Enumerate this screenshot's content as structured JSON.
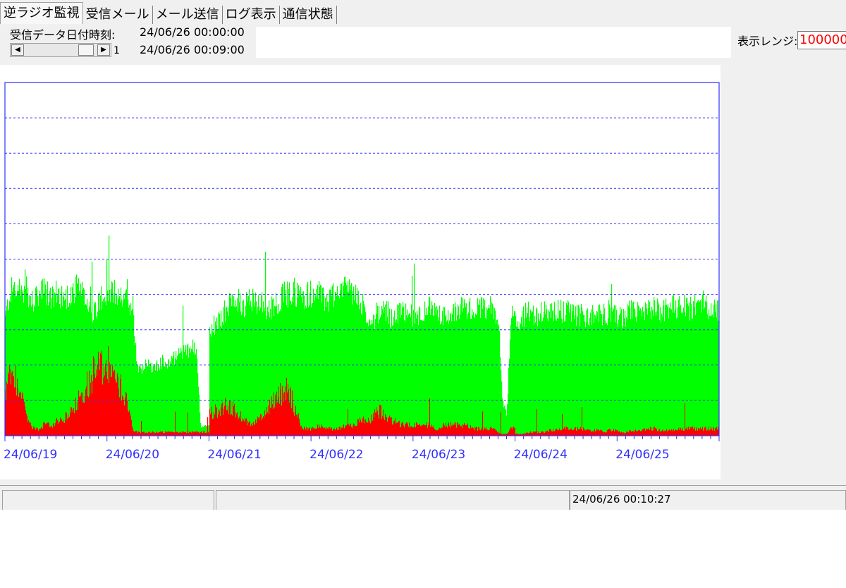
{
  "tabs": [
    {
      "label": "逆ラジオ監視",
      "active": true
    },
    {
      "label": "受信メール",
      "active": false
    },
    {
      "label": "メール送信",
      "active": false
    },
    {
      "label": "ログ表示",
      "active": false
    },
    {
      "label": "通信状態",
      "active": false
    }
  ],
  "header": {
    "received_label": "受信データ日付時刻:",
    "start_time": "24/06/26 00:00:00",
    "end_time": "24/06/26 00:09:00",
    "scroll_value": "1",
    "range_label": "表示レンジ:",
    "range_value": "100000"
  },
  "colors": {
    "green_series": "#00ff00",
    "red_series": "#ff0000",
    "axis": "#3030ff",
    "range_text": "#ff0000"
  },
  "chart_data": {
    "type": "area",
    "x_tick_labels": [
      "24/06/19",
      "24/06/20",
      "24/06/21",
      "24/06/22",
      "24/06/23",
      "24/06/24",
      "24/06/25"
    ],
    "ylim": [
      0,
      100000
    ],
    "gridlines": 10,
    "grid": true,
    "series": [
      {
        "color": "#00ff00",
        "daily_profile": [
          {
            "day": 0,
            "values": [
              0.33,
              0.4,
              0.42,
              0.41,
              0.4,
              0.39,
              0.38,
              0.38,
              0.4,
              0.41,
              0.4,
              0.39,
              0.4,
              0.4,
              0.39,
              0.4,
              0.41,
              0.42,
              0.4,
              0.38,
              0.36,
              0.35,
              0.38,
              0.4
            ]
          },
          {
            "day": 1,
            "values": [
              0.38,
              0.4,
              0.41,
              0.4,
              0.39,
              0.38,
              0.37,
              0.2,
              0.19,
              0.2,
              0.2,
              0.19,
              0.2,
              0.21,
              0.2,
              0.22,
              0.22,
              0.23,
              0.24,
              0.24,
              0.25,
              0.24,
              0.02,
              0.03
            ]
          },
          {
            "day": 2,
            "values": [
              0.3,
              0.31,
              0.32,
              0.34,
              0.36,
              0.37,
              0.38,
              0.38,
              0.37,
              0.38,
              0.39,
              0.38,
              0.37,
              0.36,
              0.36,
              0.37,
              0.38,
              0.39,
              0.4,
              0.4,
              0.41,
              0.4,
              0.39,
              0.4
            ]
          },
          {
            "day": 3,
            "values": [
              0.4,
              0.41,
              0.4,
              0.39,
              0.38,
              0.4,
              0.41,
              0.42,
              0.42,
              0.41,
              0.4,
              0.39,
              0.37,
              0.33,
              0.32,
              0.33,
              0.34,
              0.36,
              0.35,
              0.33,
              0.34,
              0.36,
              0.35,
              0.34
            ]
          },
          {
            "day": 4,
            "values": [
              0.33,
              0.34,
              0.35,
              0.36,
              0.36,
              0.35,
              0.35,
              0.34,
              0.33,
              0.34,
              0.35,
              0.36,
              0.36,
              0.36,
              0.35,
              0.36,
              0.36,
              0.35,
              0.36,
              0.35,
              0.33,
              0.1,
              0.06,
              0.34
            ]
          },
          {
            "day": 5,
            "values": [
              0.34,
              0.33,
              0.34,
              0.35,
              0.34,
              0.34,
              0.35,
              0.36,
              0.35,
              0.35,
              0.36,
              0.35,
              0.36,
              0.35,
              0.34,
              0.34,
              0.34,
              0.33,
              0.34,
              0.35,
              0.34,
              0.34,
              0.35,
              0.34
            ]
          },
          {
            "day": 6,
            "values": [
              0.34,
              0.33,
              0.34,
              0.35,
              0.36,
              0.35,
              0.34,
              0.35,
              0.36,
              0.36,
              0.35,
              0.36,
              0.36,
              0.37,
              0.36,
              0.37,
              0.36,
              0.36,
              0.37,
              0.37,
              0.38,
              0.37,
              0.36,
              0.36
            ]
          }
        ]
      },
      {
        "color": "#ff0000",
        "daily_profile": [
          {
            "day": 0,
            "values": [
              0.12,
              0.16,
              0.15,
              0.13,
              0.1,
              0.06,
              0.03,
              0.02,
              0.02,
              0.03,
              0.03,
              0.03,
              0.04,
              0.04,
              0.05,
              0.06,
              0.08,
              0.1,
              0.12,
              0.14,
              0.16,
              0.18,
              0.2,
              0.18
            ]
          },
          {
            "day": 1,
            "values": [
              0.2,
              0.18,
              0.15,
              0.14,
              0.12,
              0.09,
              0.02,
              0.01,
              0.01,
              0.01,
              0.01,
              0.01,
              0.01,
              0.01,
              0.01,
              0.01,
              0.01,
              0.01,
              0.01,
              0.01,
              0.01,
              0.01,
              0.01,
              0.01
            ]
          },
          {
            "day": 2,
            "values": [
              0.06,
              0.07,
              0.07,
              0.08,
              0.09,
              0.08,
              0.07,
              0.06,
              0.05,
              0.04,
              0.03,
              0.04,
              0.05,
              0.06,
              0.08,
              0.1,
              0.11,
              0.12,
              0.13,
              0.12,
              0.08,
              0.05,
              0.02,
              0.02
            ]
          },
          {
            "day": 3,
            "values": [
              0.02,
              0.02,
              0.03,
              0.02,
              0.02,
              0.02,
              0.02,
              0.02,
              0.03,
              0.03,
              0.03,
              0.04,
              0.04,
              0.05,
              0.05,
              0.06,
              0.07,
              0.06,
              0.05,
              0.04,
              0.04,
              0.03,
              0.03,
              0.03
            ]
          },
          {
            "day": 4,
            "values": [
              0.03,
              0.03,
              0.03,
              0.03,
              0.03,
              0.02,
              0.02,
              0.03,
              0.03,
              0.03,
              0.03,
              0.03,
              0.03,
              0.03,
              0.02,
              0.02,
              0.02,
              0.02,
              0.02,
              0.02,
              0.01,
              0.005,
              0.005,
              0.02
            ]
          },
          {
            "day": 5,
            "values": [
              0.005,
              0.005,
              0.005,
              0.01,
              0.01,
              0.01,
              0.01,
              0.01,
              0.015,
              0.015,
              0.02,
              0.02,
              0.02,
              0.02,
              0.02,
              0.02,
              0.02,
              0.015,
              0.015,
              0.015,
              0.015,
              0.01,
              0.015,
              0.015
            ]
          },
          {
            "day": 6,
            "values": [
              0.015,
              0.01,
              0.01,
              0.015,
              0.015,
              0.015,
              0.015,
              0.02,
              0.02,
              0.02,
              0.015,
              0.015,
              0.015,
              0.015,
              0.02,
              0.02,
              0.02,
              0.02,
              0.02,
              0.02,
              0.02,
              0.02,
              0.02,
              0.02
            ]
          }
        ]
      }
    ]
  },
  "status": {
    "pane1": "",
    "pane2": "",
    "clock": "24/06/26 00:10:27"
  }
}
